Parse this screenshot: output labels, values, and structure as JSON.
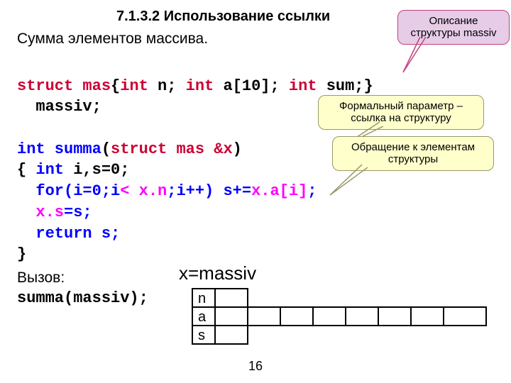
{
  "title": "7.1.3.2 Использование ссылки",
  "intro": "Сумма элементов массива.",
  "callouts": {
    "c1_line1": "Описание",
    "c1_line2": "структуры massiv",
    "c2_line1": "Формальный параметр –",
    "c2_line2": "ссылка на структуру",
    "c3_line1": "Обращение к элементам",
    "c3_line2": "структуры"
  },
  "code": {
    "l1a": "struct mas",
    "l1b": "{",
    "l1c": "int",
    "l1d": " n; ",
    "l1e": "int",
    "l1f": " a[10]; ",
    "l1g": "int",
    "l1h": " sum;}",
    "l2": "  massiv;",
    "l3a": "int summa",
    "l3b": "(",
    "l3c": "struct mas &x",
    "l3d": ")",
    "l4a": "{ ",
    "l4b": "int",
    "l4c": " i,s=0;",
    "l5a": "  for(i=0;i",
    "l5b": "< x.n",
    "l5c": ";i++) s+=",
    "l5d": "x.a[i]",
    "l5e": ";",
    "l6a": "  x.s",
    "l6b": "=s;",
    "l7": "  return s;",
    "l8": "}"
  },
  "xmassiv": "x=massiv",
  "call_label": "Вызов:",
  "call_code": "summa(massiv);",
  "diagram_labels": {
    "n": "n",
    "a": "a",
    "s": "s"
  },
  "page": "16"
}
